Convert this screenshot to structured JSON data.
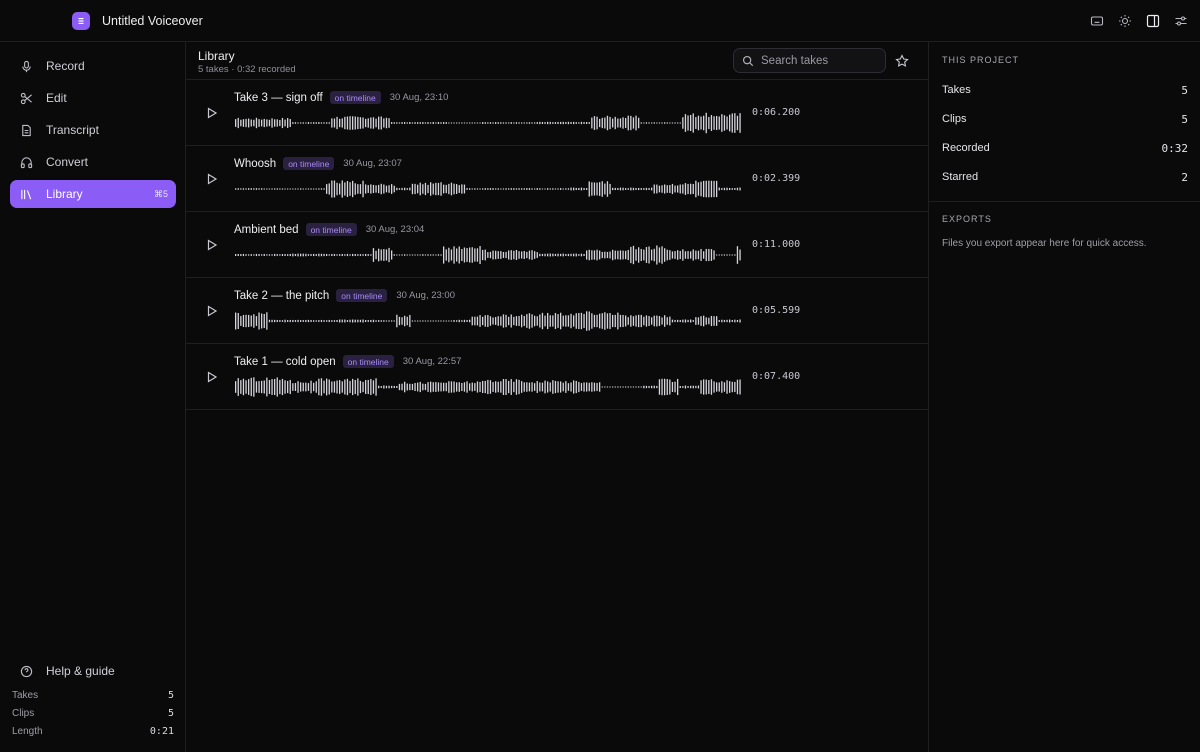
{
  "app": {
    "title": "Untitled Voiceover"
  },
  "topbar_icons": [
    "keyboard-icon",
    "sun-icon",
    "sidebar-toggle-icon",
    "sliders-icon"
  ],
  "sidebar": {
    "items": [
      {
        "label": "Record",
        "icon": "mic-icon"
      },
      {
        "label": "Edit",
        "icon": "scissors-icon"
      },
      {
        "label": "Transcript",
        "icon": "document-icon"
      },
      {
        "label": "Convert",
        "icon": "headphones-icon"
      },
      {
        "label": "Library",
        "icon": "library-icon",
        "active": true,
        "shortcut": "⌘5"
      }
    ],
    "help_label": "Help & guide",
    "stats": [
      {
        "label": "Takes",
        "value": "5"
      },
      {
        "label": "Clips",
        "value": "5"
      },
      {
        "label": "Length",
        "value": "0:21"
      }
    ]
  },
  "library": {
    "title": "Library",
    "subtitle": "5 takes · 0:32 recorded",
    "search_placeholder": "Search takes",
    "takes": [
      {
        "title": "Take 3 — sign off",
        "badge": "on timeline",
        "time": "30 Aug, 23:10",
        "duration": "0:06.200"
      },
      {
        "title": "Whoosh",
        "badge": "on timeline",
        "time": "30 Aug, 23:07",
        "duration": "0:02.399"
      },
      {
        "title": "Ambient bed",
        "badge": "on timeline",
        "time": "30 Aug, 23:04",
        "duration": "0:11.000"
      },
      {
        "title": "Take 2 — the pitch",
        "badge": "on timeline",
        "time": "30 Aug, 23:00",
        "duration": "0:05.599"
      },
      {
        "title": "Take 1 — cold open",
        "badge": "on timeline",
        "time": "30 Aug, 22:57",
        "duration": "0:07.400"
      }
    ]
  },
  "project": {
    "heading": "THIS PROJECT",
    "rows": [
      {
        "label": "Takes",
        "value": "5"
      },
      {
        "label": "Clips",
        "value": "5"
      },
      {
        "label": "Recorded",
        "value": "0:32"
      },
      {
        "label": "Starred",
        "value": "2"
      }
    ]
  },
  "exports": {
    "heading": "EXPORTS",
    "note": "Files you export appear here for quick access."
  },
  "colors": {
    "accent": "#8b5cf6",
    "badge_bg": "#2a2040",
    "badge_text": "#a98bf6",
    "background": "#0a0a0b"
  }
}
